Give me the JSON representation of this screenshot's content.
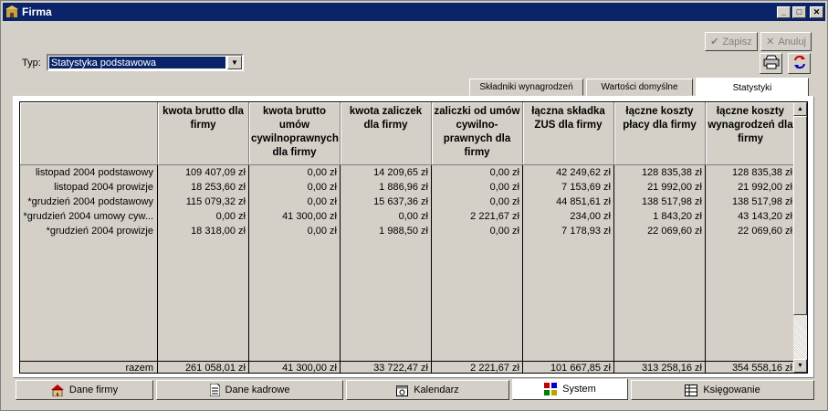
{
  "window": {
    "title": "Firma"
  },
  "toolbar": {
    "save_label": "Zapisz",
    "cancel_label": "Anuluj"
  },
  "type_field": {
    "label": "Typ:",
    "value": "Statystyka podstawowa"
  },
  "top_tabs": [
    {
      "label": "Składniki wynagrodzeń"
    },
    {
      "label": "Wartości domyślne"
    },
    {
      "label": "Statystyki"
    }
  ],
  "grid": {
    "headers": [
      "",
      "kwota brutto dla firmy",
      "kwota brutto umów cywilnoprawnych dla firmy",
      "kwota zaliczek dla firmy",
      "zaliczki od umów cywilno-prawnych dla firmy",
      "łączna składka ZUS dla firmy",
      "łączne koszty płacy dla firmy",
      "łączne koszty wynagrodzeń dla firmy"
    ],
    "rows": [
      [
        "listopad 2004 podstawowy",
        "109 407,09 zł",
        "0,00 zł",
        "14 209,65 zł",
        "0,00 zł",
        "42 249,62 zł",
        "128 835,38 zł",
        "128 835,38 zł"
      ],
      [
        "listopad 2004 prowizje",
        "18 253,60 zł",
        "0,00 zł",
        "1 886,96 zł",
        "0,00 zł",
        "7 153,69 zł",
        "21 992,00 zł",
        "21 992,00 zł"
      ],
      [
        "*grudzień 2004 podstawowy",
        "115 079,32 zł",
        "0,00 zł",
        "15 637,36 zł",
        "0,00 zł",
        "44 851,61 zł",
        "138 517,98 zł",
        "138 517,98 zł"
      ],
      [
        "*grudzień 2004 umowy cyw...",
        "0,00 zł",
        "41 300,00 zł",
        "0,00 zł",
        "2 221,67 zł",
        "234,00 zł",
        "1 843,20 zł",
        "43 143,20 zł"
      ],
      [
        "*grudzień 2004 prowizje",
        "18 318,00 zł",
        "0,00 zł",
        "1 988,50 zł",
        "0,00 zł",
        "7 178,93 zł",
        "22 069,60 zł",
        "22 069,60 zł"
      ]
    ],
    "totals": [
      "razem",
      "261 058,01 zł",
      "41 300,00 zł",
      "33 722,47 zł",
      "2 221,67 zł",
      "101 667,85 zł",
      "313 258,16 zł",
      "354 558,16 zł"
    ]
  },
  "bottom_tabs": [
    {
      "label": "Dane firmy",
      "icon": "house-icon"
    },
    {
      "label": "Dane kadrowe",
      "icon": "document-icon"
    },
    {
      "label": "Kalendarz",
      "icon": "calendar-icon"
    },
    {
      "label": "System",
      "icon": "system-icon"
    },
    {
      "label": "Księgowanie",
      "icon": "ledger-icon"
    }
  ]
}
